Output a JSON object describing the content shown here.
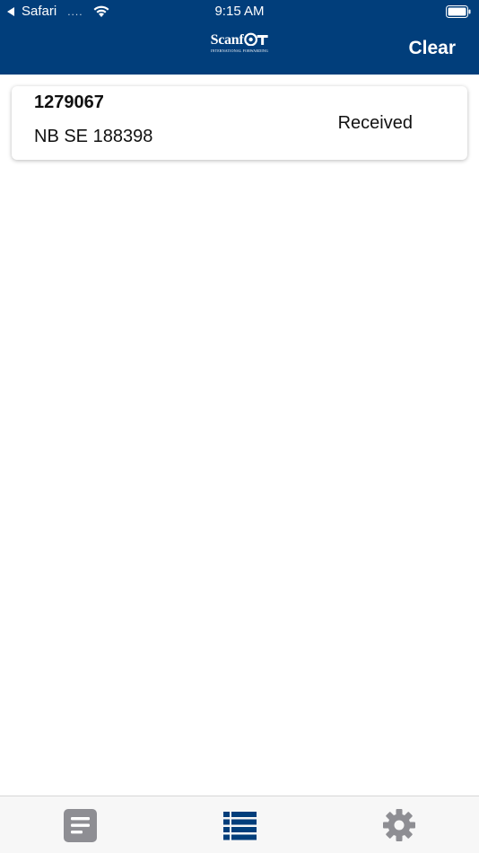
{
  "status_bar": {
    "back_app": "Safari",
    "signal": "....",
    "time": "9:15 AM"
  },
  "nav": {
    "logo_text": "Scanf",
    "logo_subtitle": "INTERNATIONAL FORWARDING",
    "clear_label": "Clear"
  },
  "shipments": [
    {
      "id": "1279067",
      "reference": "NB SE 188398",
      "status": "Received"
    }
  ],
  "tabs": [
    {
      "icon": "document-icon",
      "active": false
    },
    {
      "icon": "list-icon",
      "active": true
    },
    {
      "icon": "gear-icon",
      "active": false
    }
  ],
  "colors": {
    "header": "#013e7b",
    "tab_active": "#013e7b",
    "tab_inactive": "#8e8e93"
  }
}
